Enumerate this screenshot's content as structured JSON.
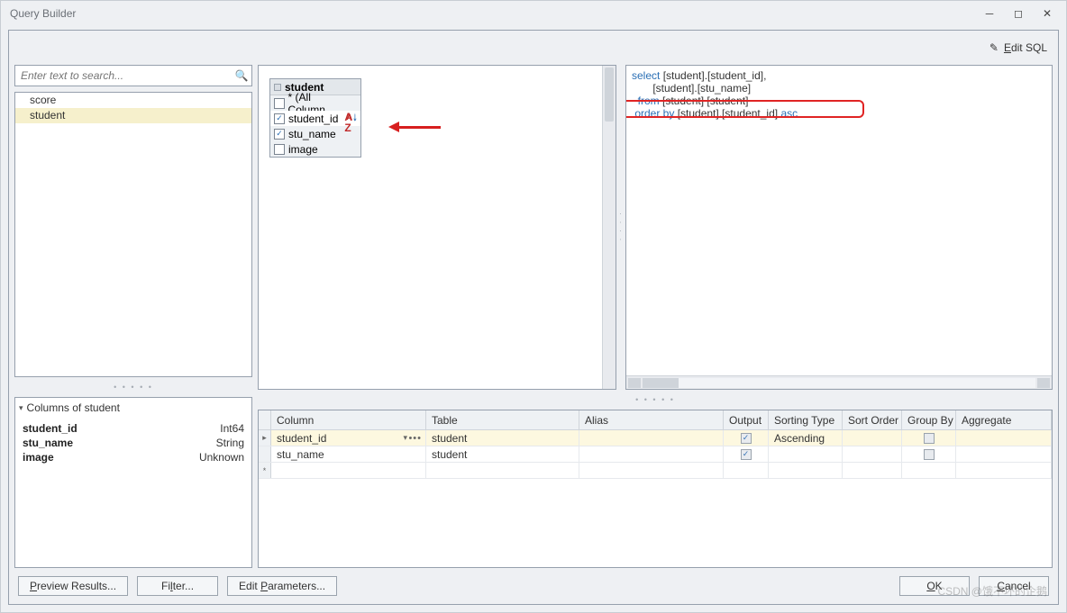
{
  "window": {
    "title": "Query Builder"
  },
  "toolbar": {
    "edit_sql_prefix": "E",
    "edit_sql_rest": "dit SQL"
  },
  "search": {
    "placeholder": "Enter text to search..."
  },
  "tables": {
    "items": [
      "score",
      "student"
    ],
    "selected_index": 1
  },
  "columns_panel": {
    "header_prefix": "Columns of ",
    "header_table": "student",
    "rows": [
      {
        "name": "student_id",
        "type": "Int64"
      },
      {
        "name": "stu_name",
        "type": "String"
      },
      {
        "name": "image",
        "type": "Unknown"
      }
    ]
  },
  "diagram": {
    "table_name": "student",
    "columns": [
      {
        "label": "* (All Column...",
        "checked": false,
        "sort": false
      },
      {
        "label": "student_id",
        "checked": true,
        "sort": true
      },
      {
        "label": "stu_name",
        "checked": true,
        "sort": false
      },
      {
        "label": "image",
        "checked": false,
        "sort": false
      }
    ]
  },
  "sql": {
    "line1_kw": "select",
    "line1_rest": " [student].[student_id],",
    "line2": "       [student].[stu_name]",
    "line3_kw": "  from",
    "line3_rest": " [student] [student]",
    "line4_kw": " order by",
    "line4_mid": " [student].[student_id] ",
    "line4_asc": "asc"
  },
  "grid": {
    "headers": [
      "Column",
      "Table",
      "Alias",
      "Output",
      "Sorting Type",
      "Sort Order",
      "Group By",
      "Aggregate"
    ],
    "rows": [
      {
        "column": "student_id",
        "table": "student",
        "alias": "",
        "output": true,
        "sorting_type": "Ascending",
        "sort_order": "",
        "group_by": false,
        "aggregate": "",
        "current": true
      },
      {
        "column": "stu_name",
        "table": "student",
        "alias": "",
        "output": true,
        "sorting_type": "",
        "sort_order": "",
        "group_by": false,
        "aggregate": "",
        "current": false
      }
    ]
  },
  "buttons": {
    "preview_pre": "P",
    "preview_rest": "review Results...",
    "filter_pre": "Fi",
    "filter_u": "l",
    "filter_rest": "ter...",
    "params_pre": "Edit ",
    "params_u": "P",
    "params_rest": "arameters...",
    "ok_u": "O",
    "ok_rest": "K",
    "cancel_u": "C",
    "cancel_rest": "ancel"
  },
  "watermark": "CSDN @饿不坏的企鹅"
}
